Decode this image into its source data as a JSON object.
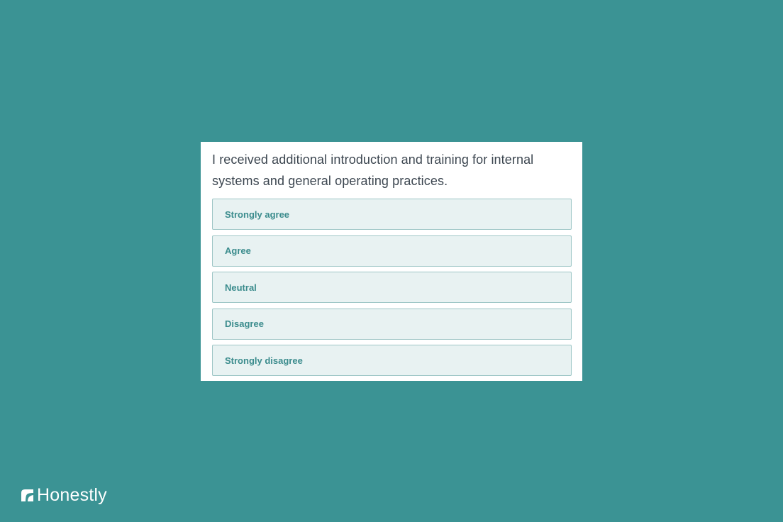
{
  "question": {
    "text": "I received additional introduction and training for internal systems and general operating practices."
  },
  "options": [
    {
      "label": "Strongly agree"
    },
    {
      "label": "Agree"
    },
    {
      "label": "Neutral"
    },
    {
      "label": "Disagree"
    },
    {
      "label": "Strongly disagree"
    }
  ],
  "brand": {
    "name": "Honestly",
    "logo_icon": "honestly-logo-icon"
  },
  "colors": {
    "background": "#3b9394",
    "card": "#ffffff",
    "option_background": "#e8f2f2",
    "option_border": "#9ec6c6",
    "option_text": "#3b8c8d",
    "question_text": "#3c4650"
  }
}
